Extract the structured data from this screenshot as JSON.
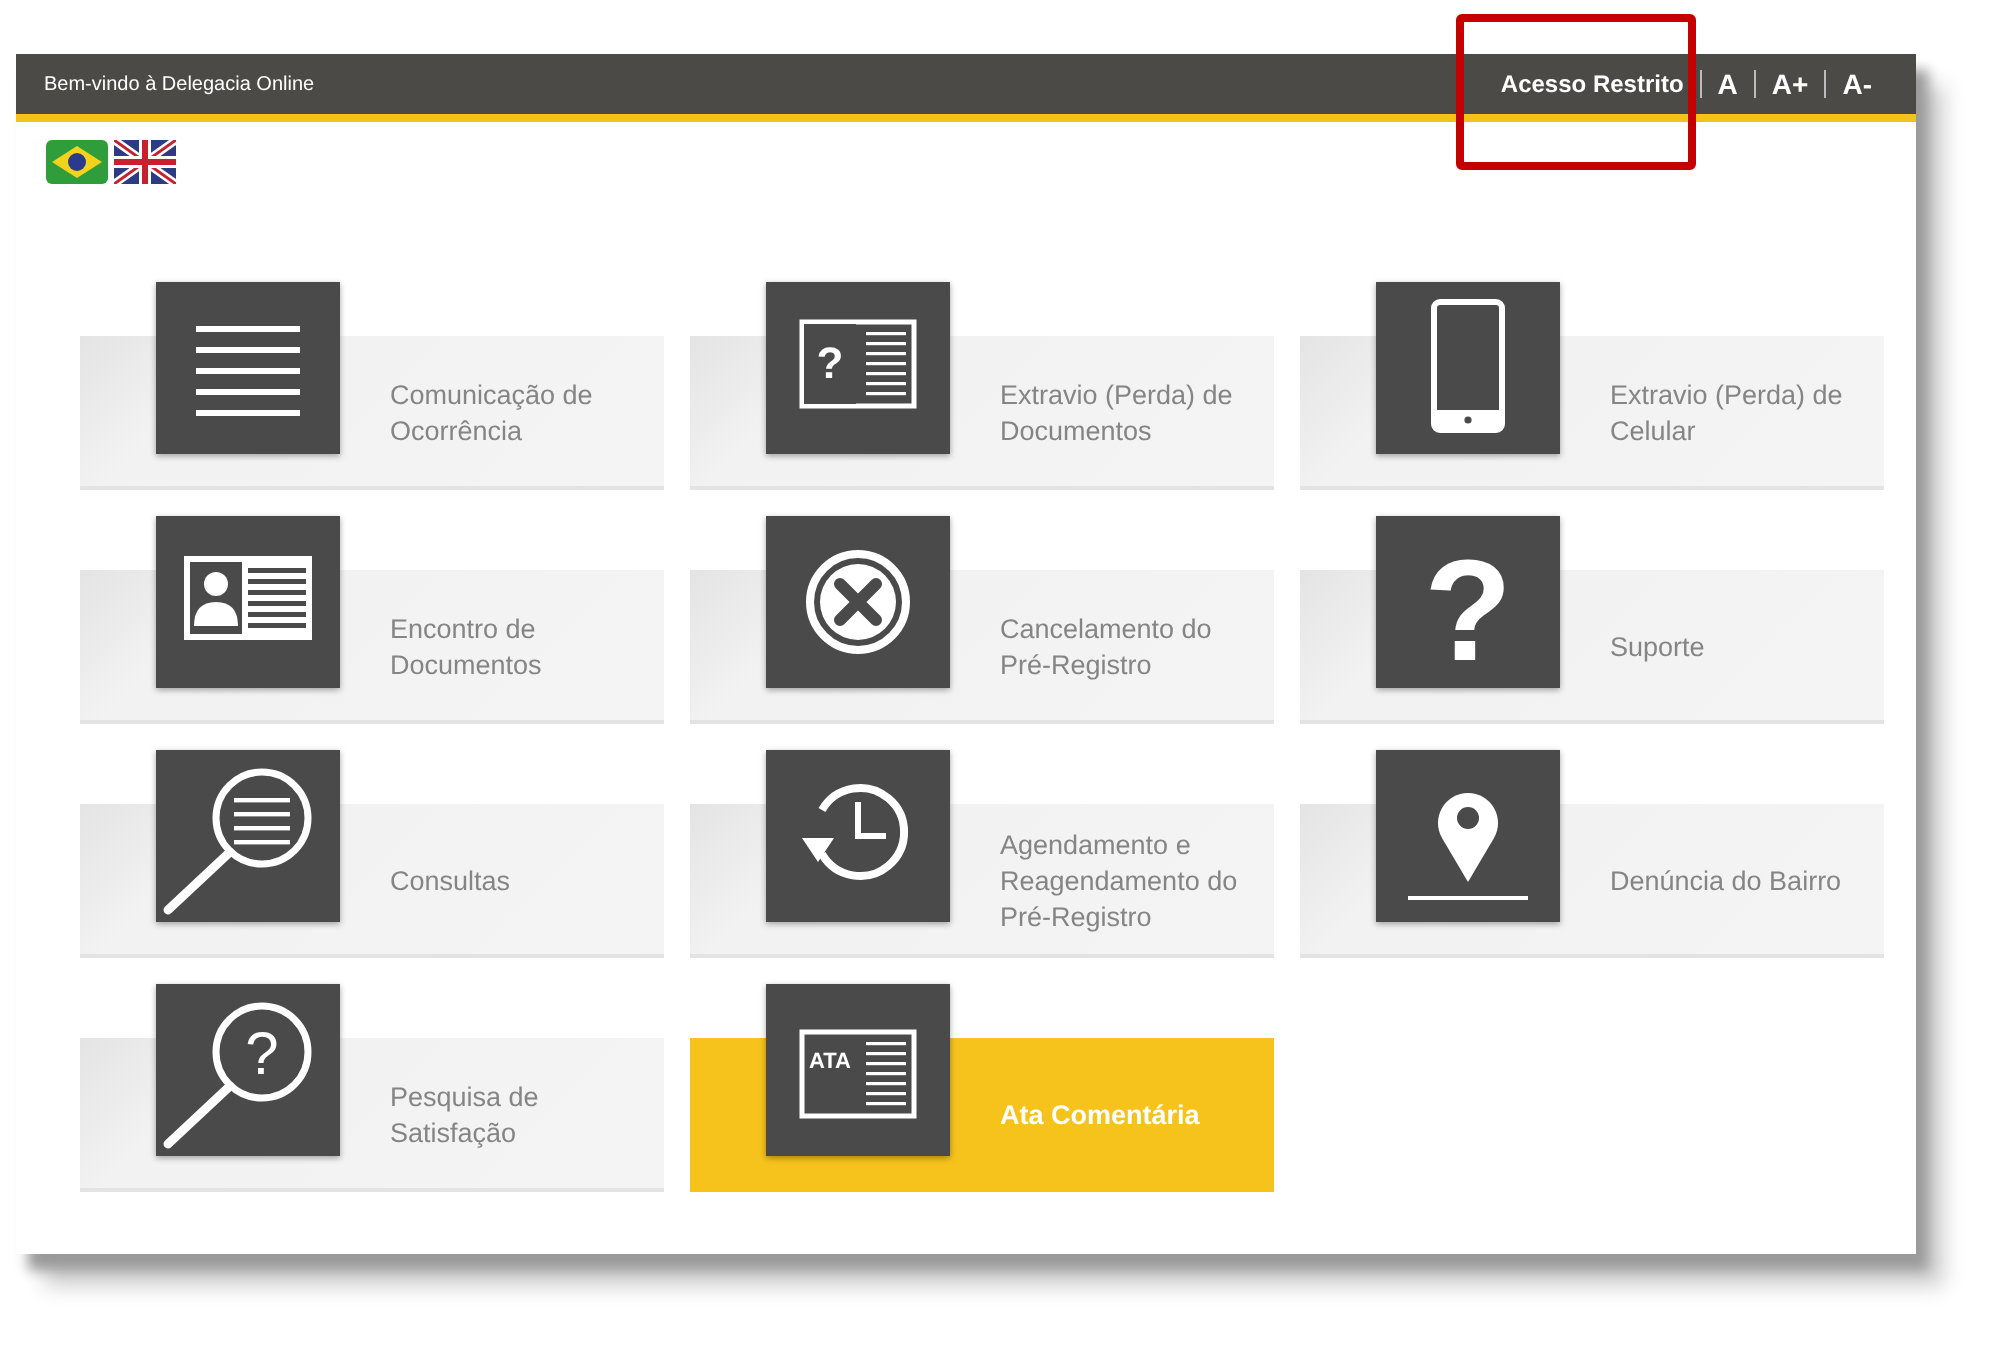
{
  "header": {
    "welcome": "Bem-vindo à Delegacia Online",
    "links": [
      {
        "label": "Acesso Restrito",
        "highlighted": true
      },
      {
        "label": "A",
        "highlighted": false
      },
      {
        "label": "A+",
        "highlighted": false
      },
      {
        "label": "A-",
        "highlighted": false
      }
    ]
  },
  "languages": [
    {
      "kind": "brazil"
    },
    {
      "kind": "uk"
    }
  ],
  "services": [
    {
      "label": "Comunicação de Ocorrência",
      "kind": "lines",
      "selected": false
    },
    {
      "label": "Extravio (Perda) de Documentos",
      "kind": "doc-question",
      "icon_text": "?",
      "selected": false
    },
    {
      "label": "Extravio (Perda) de Celular",
      "kind": "phone",
      "selected": false
    },
    {
      "label": "Encontro de Documentos",
      "kind": "id-card",
      "selected": false
    },
    {
      "label": "Cancelamento do Pré-Registro",
      "kind": "cancel",
      "selected": false
    },
    {
      "label": "Suporte",
      "kind": "question",
      "icon_text": "?",
      "selected": false
    },
    {
      "label": "Consultas",
      "kind": "search-lines",
      "selected": false
    },
    {
      "label": "Agendamento e Reagendamento do Pré-Registro",
      "kind": "history",
      "selected": false
    },
    {
      "label": "Denúncia do Bairro",
      "kind": "pin",
      "selected": false
    },
    {
      "label": "Pesquisa de Satisfação",
      "kind": "search-question",
      "icon_text": "?",
      "selected": false
    },
    {
      "label": "Ata Comentária",
      "kind": "doc-ata",
      "icon_text": "ATA",
      "selected": true
    }
  ]
}
